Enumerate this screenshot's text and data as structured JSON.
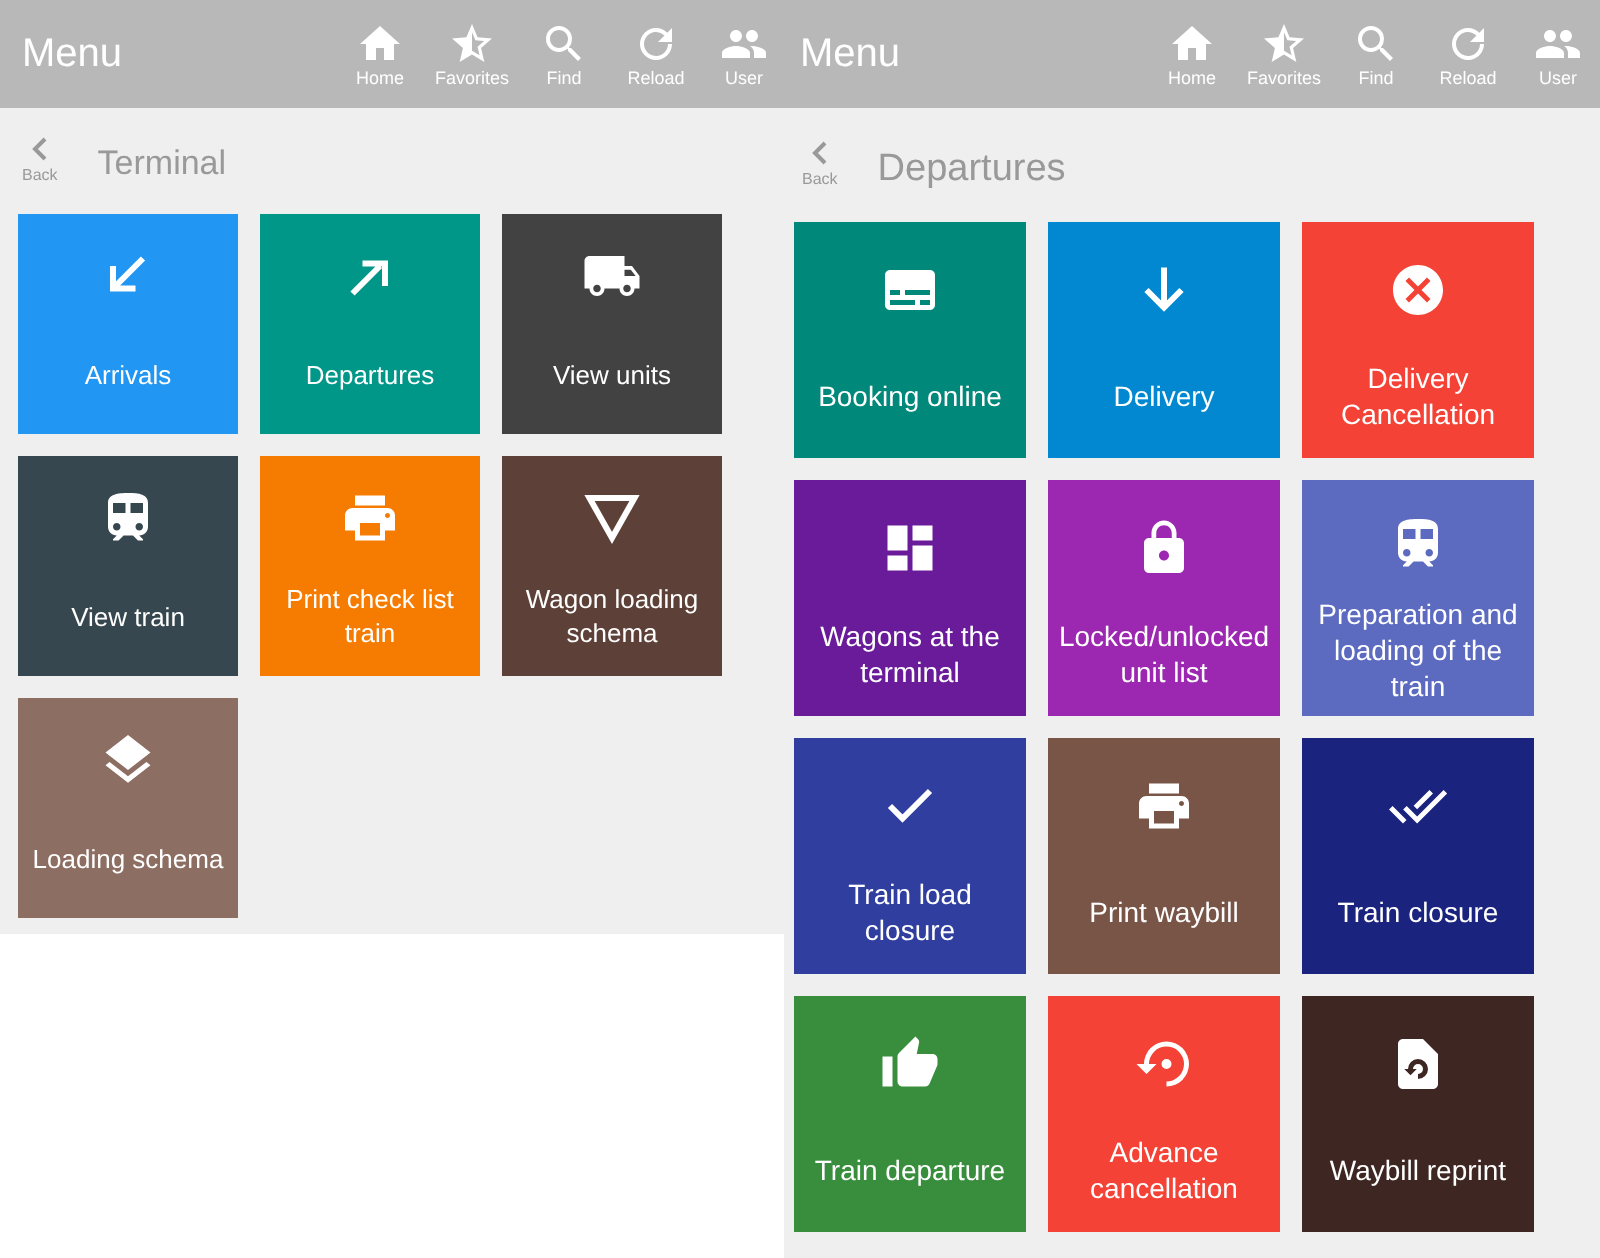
{
  "panels": [
    {
      "header": {
        "title": "Menu",
        "nav": [
          {
            "label": "Home",
            "kind": "home"
          },
          {
            "label": "Favorites",
            "kind": "star-half"
          },
          {
            "label": "Find",
            "kind": "search"
          },
          {
            "label": "Reload",
            "kind": "reload"
          },
          {
            "label": "User",
            "kind": "group"
          }
        ]
      },
      "back_label": "Back",
      "title": "Terminal",
      "tiles": [
        {
          "label": "Arrivals",
          "kind": "arrow-down-left",
          "color": "#2196f3"
        },
        {
          "label": "Departures",
          "kind": "arrow-up-right",
          "color": "#009688"
        },
        {
          "label": "View units",
          "kind": "truck",
          "color": "#424242"
        },
        {
          "label": "View train",
          "kind": "train",
          "color": "#37474f"
        },
        {
          "label": "Print check list train",
          "kind": "printer",
          "color": "#f57c00"
        },
        {
          "label": "Wagon loading schema",
          "kind": "triangle",
          "color": "#5d4037"
        },
        {
          "label": "Loading schema",
          "kind": "layers",
          "color": "#8d6e63"
        }
      ]
    },
    {
      "header": {
        "title": "Menu",
        "nav": [
          {
            "label": "Home",
            "kind": "home"
          },
          {
            "label": "Favorites",
            "kind": "star-half"
          },
          {
            "label": "Find",
            "kind": "search"
          },
          {
            "label": "Reload",
            "kind": "reload"
          },
          {
            "label": "User",
            "kind": "group"
          }
        ]
      },
      "back_label": "Back",
      "title": "Departures",
      "tiles": [
        {
          "label": "Booking online",
          "kind": "card",
          "color": "#00897b"
        },
        {
          "label": "Delivery",
          "kind": "arrow-down",
          "color": "#0288d1"
        },
        {
          "label": "Delivery Cancellation",
          "kind": "cancel",
          "color": "#f44336"
        },
        {
          "label": "Wagons at the terminal",
          "kind": "dashboard",
          "color": "#6a1b9a"
        },
        {
          "label": "Locked/unlocked unit list",
          "kind": "lock",
          "color": "#9c27b0"
        },
        {
          "label": "Preparation and loading of the train",
          "kind": "train",
          "color": "#5c6bc0"
        },
        {
          "label": "Train load closure",
          "kind": "check",
          "color": "#303f9f"
        },
        {
          "label": "Print waybill",
          "kind": "printer",
          "color": "#795548"
        },
        {
          "label": "Train closure",
          "kind": "double-check",
          "color": "#1a237e"
        },
        {
          "label": "Train departure",
          "kind": "thumb-up",
          "color": "#388e3c"
        },
        {
          "label": "Advance cancellation",
          "kind": "restore",
          "color": "#f44336"
        },
        {
          "label": "Waybill reprint",
          "kind": "file-restore",
          "color": "#3e2723"
        }
      ]
    }
  ]
}
